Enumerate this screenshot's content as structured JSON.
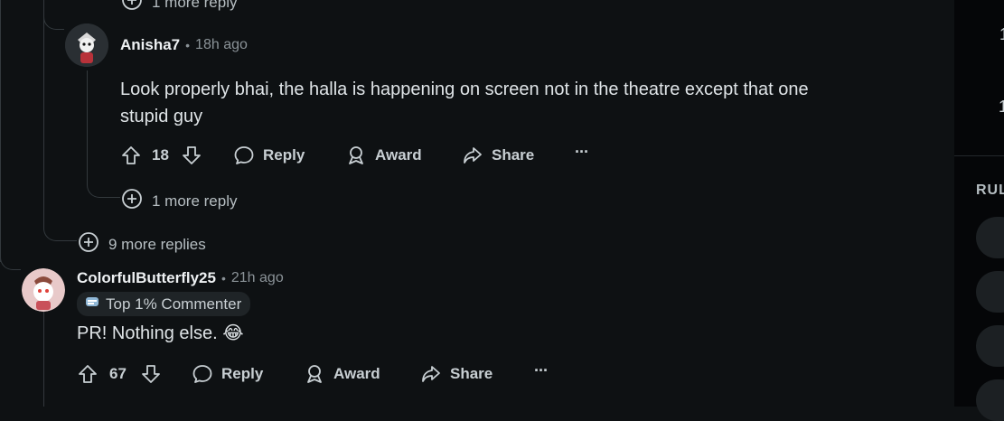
{
  "top_partial": {
    "label": "1 more reply"
  },
  "reply": {
    "author": "Anisha7",
    "separator": "•",
    "time": "18h ago",
    "body_line1": "Look properly bhai, the halla is happening on screen not in the theatre except that one",
    "body_line2": "stupid guy",
    "votes": "18",
    "reply_label": "Reply",
    "award_label": "Award",
    "share_label": "Share",
    "more_label": "···",
    "more_replies": "1 more reply"
  },
  "thread_more_replies": "9 more replies",
  "comment": {
    "author": "ColorfulButterfly25",
    "separator": "•",
    "time": "21h ago",
    "badge": "Top 1% Commenter",
    "body": "PR! Nothing else. 😂",
    "votes": "67",
    "reply_label": "Reply",
    "award_label": "Award",
    "share_label": "Share",
    "more_label": "···"
  },
  "sidebar": {
    "heading": "RUL",
    "stat1": "1",
    "stat2": "1"
  },
  "colors": {
    "background": "#0e1113",
    "sidebar": "#050608",
    "text": "#dfe4e7",
    "muted": "#8a9297",
    "thread_line": "#33393d"
  }
}
